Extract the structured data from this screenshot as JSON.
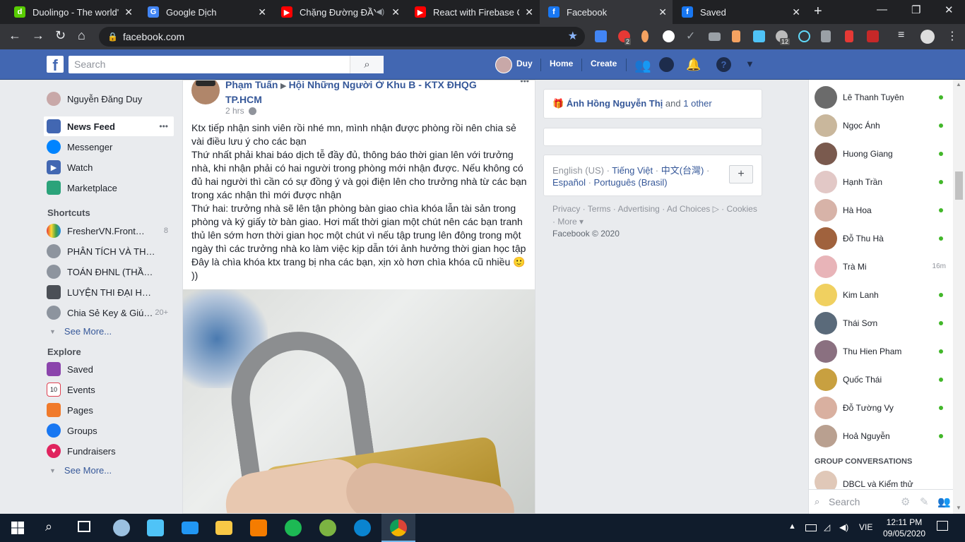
{
  "browser": {
    "tabs": [
      {
        "title": "Duolingo - The world's",
        "color": "#58cc02",
        "glyph": "d"
      },
      {
        "title": "Google Dịch",
        "color": "#4285f4",
        "glyph": "G"
      },
      {
        "title": "Chặng Đường ĐẦY",
        "color": "#ff0000",
        "glyph": "▶"
      },
      {
        "title": "React with Firebase CRU",
        "color": "#ff0000",
        "glyph": "▶"
      },
      {
        "title": "Facebook",
        "color": "#1877f2",
        "glyph": "f"
      },
      {
        "title": "Saved",
        "color": "#1877f2",
        "glyph": "f"
      }
    ],
    "close_glyph": "✕",
    "newtab_glyph": "+",
    "url": "facebook.com",
    "ext_badges": [
      "2",
      "12"
    ]
  },
  "fb": {
    "search_placeholder": "Search",
    "user": "Duy",
    "home": "Home",
    "create": "Create"
  },
  "left": {
    "profile": "Nguyễn Đăng Duy",
    "nav": [
      {
        "label": "News Feed",
        "icon": "news-feed-icon",
        "color": "#4267b2"
      },
      {
        "label": "Messenger",
        "icon": "messenger-icon",
        "color": "#0084ff"
      },
      {
        "label": "Watch",
        "icon": "watch-icon",
        "color": "#4267b2"
      },
      {
        "label": "Marketplace",
        "icon": "marketplace-icon",
        "color": "#2ba37a"
      }
    ],
    "more_glyph": "•••",
    "shortcuts_title": "Shortcuts",
    "shortcuts": [
      {
        "label": "FresherVN.Front…",
        "count": "8",
        "color": "#e8873a"
      },
      {
        "label": "PHÂN TÍCH VÀ TH…",
        "count": "",
        "color": "#8d949e"
      },
      {
        "label": "TOÁN ĐHNL (THẦ…",
        "count": "",
        "color": "#8d949e"
      },
      {
        "label": "LUYỆN THI ĐẠI H…",
        "count": "",
        "color": "#4b4f56"
      },
      {
        "label": "Chia Sẻ Key & Giú…",
        "count": "20+",
        "color": "#8d949e"
      }
    ],
    "see_more": "See More...",
    "explore_title": "Explore",
    "explore": [
      {
        "label": "Saved",
        "color": "#8b44ac"
      },
      {
        "label": "Events",
        "color": "#e04050"
      },
      {
        "label": "Pages",
        "color": "#f07a2b"
      },
      {
        "label": "Groups",
        "color": "#1877f2"
      },
      {
        "label": "Fundraisers",
        "color": "#e0245e"
      }
    ],
    "see_more2": "See More..."
  },
  "post": {
    "author": "Phạm Tuấn",
    "group": "Hội Những Người Ở Khu B - KTX ĐHQG TP.HCM",
    "time": "2 hrs",
    "menu": "•••",
    "paragraphs": [
      "Ktx tiếp nhận sinh viên rồi nhé mn, mình nhận được phòng rồi nên chia sẻ vài điều lưu ý cho các bạn",
      "Thứ nhất phải khai báo dịch tễ đầy đủ, thông báo thời gian lên với trưởng nhà, khi nhận phải có hai người trong phòng mới nhận được. Nếu không có đủ hai người thì cần có sự đồng ý và gọi điện lên cho trưởng nhà từ các bạn trong xác nhận thì mới được nhận",
      "Thứ hai: trưởng nhà sẽ lên tận phòng bàn giao chìa khóa lẫn tài sản trong phòng và ký giấy tờ bàn giao. Hơi mất thời gian một chút nên các bạn tranh thủ lên sớm hơn thời gian học một chút vì nếu tập trung lên đông trong một ngày thì các trưởng nhà ko làm việc kịp dẫn tới ảnh hưởng thời gian học tập",
      "Đây là chìa khóa ktx trang bị nha các bạn, xịn xò hơn chìa khóa cũ nhiều 🙂 ))"
    ]
  },
  "right": {
    "birthday_name": "Ánh Hồng Nguyễn Thị",
    "birthday_and": "and",
    "birthday_other": "1 other",
    "languages": [
      "English (US)",
      "Tiếng Việt",
      "中文(台灣)",
      "Español",
      "Português (Brasil)"
    ],
    "lang_add": "+",
    "footer_links": [
      "Privacy",
      "Terms",
      "Advertising",
      "Ad Choices",
      "Cookies",
      "More"
    ],
    "copyright": "Facebook © 2020"
  },
  "chat": {
    "contacts": [
      {
        "name": "Lê Thanh Tuyên",
        "time": "",
        "color": "#6b6b6b"
      },
      {
        "name": "Ngọc Ánh",
        "time": "",
        "color": "#c9b79c"
      },
      {
        "name": "Huong Giang",
        "time": "",
        "color": "#7a5a4e"
      },
      {
        "name": "Hạnh Trần",
        "time": "",
        "color": "#e2c8c6"
      },
      {
        "name": "Hà Hoa",
        "time": "",
        "color": "#d7b3a8"
      },
      {
        "name": "Đỗ Thu Hà",
        "time": "",
        "color": "#a0623d"
      },
      {
        "name": "Trà Mi",
        "time": "16m",
        "color": "#e8b4b8"
      },
      {
        "name": "Kim Lanh",
        "time": "",
        "color": "#f0d060"
      },
      {
        "name": "Thái Sơn",
        "time": "",
        "color": "#5a6a7a"
      },
      {
        "name": "Thu Hien Pham",
        "time": "",
        "color": "#8a7080"
      },
      {
        "name": "Quốc Thái",
        "time": "",
        "color": "#c8a040"
      },
      {
        "name": "Đỗ Tường Vy",
        "time": "",
        "color": "#d9b0a0"
      },
      {
        "name": "Hoả Nguyễn",
        "time": "",
        "color": "#b9a090"
      }
    ],
    "group_title": "GROUP CONVERSATIONS",
    "group_first": "DBCL và Kiểm thử",
    "search": "Search"
  },
  "taskbar": {
    "lang": "VIE",
    "time": "12:11 PM",
    "date": "09/05/2020"
  }
}
